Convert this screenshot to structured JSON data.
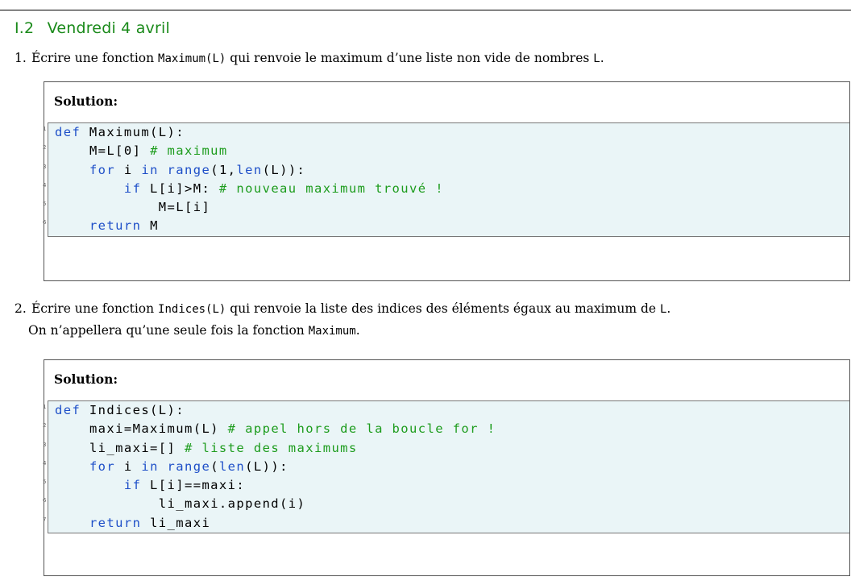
{
  "section": {
    "number": "I.2",
    "title": "Vendredi 4 avril"
  },
  "q1": {
    "number": "1.",
    "text_before": "Écrire une fonction ",
    "func": "Maximum(L)",
    "text_middle": " qui renvoie le maximum d’une liste non vide de nombres ",
    "var": "L",
    "text_after": "."
  },
  "q2": {
    "number": "2.",
    "text_before": "Écrire une fonction ",
    "func": "Indices(L)",
    "text_middle": " qui renvoie la liste des indices des éléments égaux au maximum de ",
    "var": "L",
    "text_after": ".",
    "line2_before": "On n’appellera qu’une seule fois la fonction ",
    "line2_func": "Maximum",
    "line2_after": "."
  },
  "solution_label": "Solution:",
  "code1": [
    {
      "n": "1",
      "indent": "",
      "parts": [
        {
          "t": "kw",
          "v": "def"
        },
        {
          "t": "",
          "v": " Maximum(L):"
        }
      ]
    },
    {
      "n": "2",
      "indent": "    ",
      "parts": [
        {
          "t": "",
          "v": "M=L[0] "
        },
        {
          "t": "cm",
          "v": "# maximum"
        }
      ]
    },
    {
      "n": "3",
      "indent": "    ",
      "parts": [
        {
          "t": "kw",
          "v": "for"
        },
        {
          "t": "",
          "v": " i "
        },
        {
          "t": "kw",
          "v": "in"
        },
        {
          "t": "",
          "v": " "
        },
        {
          "t": "kw",
          "v": "range"
        },
        {
          "t": "",
          "v": "(1,"
        },
        {
          "t": "kw",
          "v": "len"
        },
        {
          "t": "",
          "v": "(L)):"
        }
      ]
    },
    {
      "n": "4",
      "indent": "        ",
      "parts": [
        {
          "t": "kw",
          "v": "if"
        },
        {
          "t": "",
          "v": " L[i]>M: "
        },
        {
          "t": "cm",
          "v": "# nouveau maximum trouvé !"
        }
      ]
    },
    {
      "n": "5",
      "indent": "            ",
      "parts": [
        {
          "t": "",
          "v": "M=L[i]"
        }
      ]
    },
    {
      "n": "6",
      "indent": "    ",
      "parts": [
        {
          "t": "kw",
          "v": "return"
        },
        {
          "t": "",
          "v": " M"
        }
      ]
    }
  ],
  "code2": [
    {
      "n": "1",
      "indent": "",
      "parts": [
        {
          "t": "kw",
          "v": "def"
        },
        {
          "t": "",
          "v": " Indices(L):"
        }
      ]
    },
    {
      "n": "2",
      "indent": "    ",
      "parts": [
        {
          "t": "",
          "v": "maxi=Maximum(L) "
        },
        {
          "t": "cm",
          "v": "# appel hors de la boucle for !"
        }
      ]
    },
    {
      "n": "3",
      "indent": "    ",
      "parts": [
        {
          "t": "",
          "v": "li_maxi=[] "
        },
        {
          "t": "cm",
          "v": "# liste des maximums"
        }
      ]
    },
    {
      "n": "4",
      "indent": "    ",
      "parts": [
        {
          "t": "kw",
          "v": "for"
        },
        {
          "t": "",
          "v": " i "
        },
        {
          "t": "kw",
          "v": "in"
        },
        {
          "t": "",
          "v": " "
        },
        {
          "t": "kw",
          "v": "range"
        },
        {
          "t": "",
          "v": "("
        },
        {
          "t": "kw",
          "v": "len"
        },
        {
          "t": "",
          "v": "(L)):"
        }
      ]
    },
    {
      "n": "5",
      "indent": "        ",
      "parts": [
        {
          "t": "kw",
          "v": "if"
        },
        {
          "t": "",
          "v": " L[i]==maxi:"
        }
      ]
    },
    {
      "n": "6",
      "indent": "            ",
      "parts": [
        {
          "t": "",
          "v": "li_maxi.append(i)"
        }
      ]
    },
    {
      "n": "7",
      "indent": "    ",
      "parts": [
        {
          "t": "kw",
          "v": "return"
        },
        {
          "t": "",
          "v": " li_maxi"
        }
      ]
    }
  ],
  "colors": {
    "section": "#1a8a1a",
    "keyword": "#1e4fc8",
    "comment": "#1d9c1d",
    "code_bg": "#eaf5f7"
  }
}
